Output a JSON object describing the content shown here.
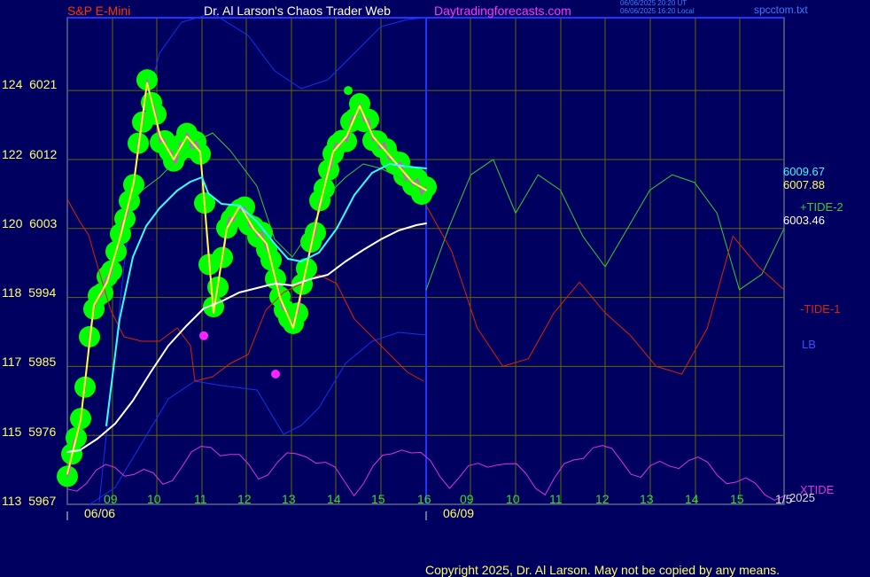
{
  "header": {
    "symbol": "S&P E-Mini",
    "author": "Dr. Al Larson's Chaos Trader Web",
    "site": "Daytradingforecasts.com",
    "stamp_line1": "06/06/2025 20:20 UT",
    "stamp_line2": "06/06/2025 16:20 Local",
    "file": "spcctom.txt"
  },
  "footer": {
    "copyright": "Copyright 2025, Dr. Al Larson. May not be copied by any means."
  },
  "colors": {
    "background": "#000060",
    "frame": "#2233ff",
    "grid": "#666600",
    "price": "#ff33ff",
    "price_glow": "#00ff00",
    "smooth": "#ffff33",
    "avg_cyan": "#33ffff",
    "avg_white": "#ffffff",
    "band": "#1133ee",
    "tide_plus": "#33cc33",
    "tide_minus": "#dd2200",
    "xtide": "#dd33dd"
  },
  "y_axis": {
    "labels": [
      {
        "idx": "113",
        "price": "5967"
      },
      {
        "idx": "115",
        "price": "5976"
      },
      {
        "idx": "117",
        "price": "5985"
      },
      {
        "idx": "118",
        "price": "5994"
      },
      {
        "idx": "120",
        "price": "6003"
      },
      {
        "idx": "122",
        "price": "6012"
      },
      {
        "idx": "124",
        "price": "6021"
      }
    ]
  },
  "x_axis": {
    "hours": [
      "09",
      "10",
      "11",
      "12",
      "13",
      "14",
      "15",
      "16",
      "09",
      "10",
      "11",
      "12",
      "13",
      "14",
      "15",
      "1/5"
    ],
    "dates": [
      "06/06",
      "06/09"
    ]
  },
  "right_labels": {
    "v1": "6009.67",
    "v2": "6007.88",
    "tide_plus": "+TIDE-2",
    "v3": "6003.46",
    "tide_minus": "-TIDE-1",
    "lb": "LB",
    "xtide": "XTIDE",
    "year": "2025"
  },
  "chart_data": {
    "type": "line",
    "title": "S&P E-Mini",
    "ylabel": "",
    "ylim": [
      5967,
      6030
    ],
    "x_ticks": [
      "09",
      "10",
      "11",
      "12",
      "13",
      "14",
      "15",
      "16",
      "09",
      "10",
      "11",
      "12",
      "13",
      "14",
      "15"
    ],
    "series": [
      {
        "name": "price",
        "values": [
          5971,
          5978,
          5993,
          5996,
          6002,
          6009,
          6022,
          6015,
          6012,
          6015,
          6013,
          5992,
          6003,
          6006,
          6003,
          6001,
          5994,
          5990,
          5998,
          6006,
          6013,
          6015,
          6019,
          6015,
          6013,
          6011,
          6009,
          6008
        ]
      },
      {
        "name": "+TIDE-2",
        "values": [
          5995,
          6003,
          6010,
          6012,
          6005,
          6010,
          6008,
          6002,
          5998,
          6003,
          6008,
          6010,
          6009,
          6005,
          5995,
          5997,
          6003
        ]
      },
      {
        "name": "-TIDE-1",
        "values": [
          6006,
          6000,
          5990,
          5985,
          5986,
          5992,
          5996,
          5992,
          5989,
          5985,
          5984,
          5990,
          6002,
          5998,
          5995
        ]
      },
      {
        "name": "XTIDE",
        "values": [
          5969,
          5972,
          5970,
          5975,
          5971,
          5974,
          5969,
          5975,
          5970,
          5973,
          5969,
          5975,
          5971,
          5973,
          5970,
          5968
        ]
      }
    ],
    "markers": [
      {
        "value": 5989,
        "color": "magenta"
      },
      {
        "value": 5984,
        "color": "magenta"
      },
      {
        "value": 6021,
        "color": "green"
      }
    ]
  }
}
